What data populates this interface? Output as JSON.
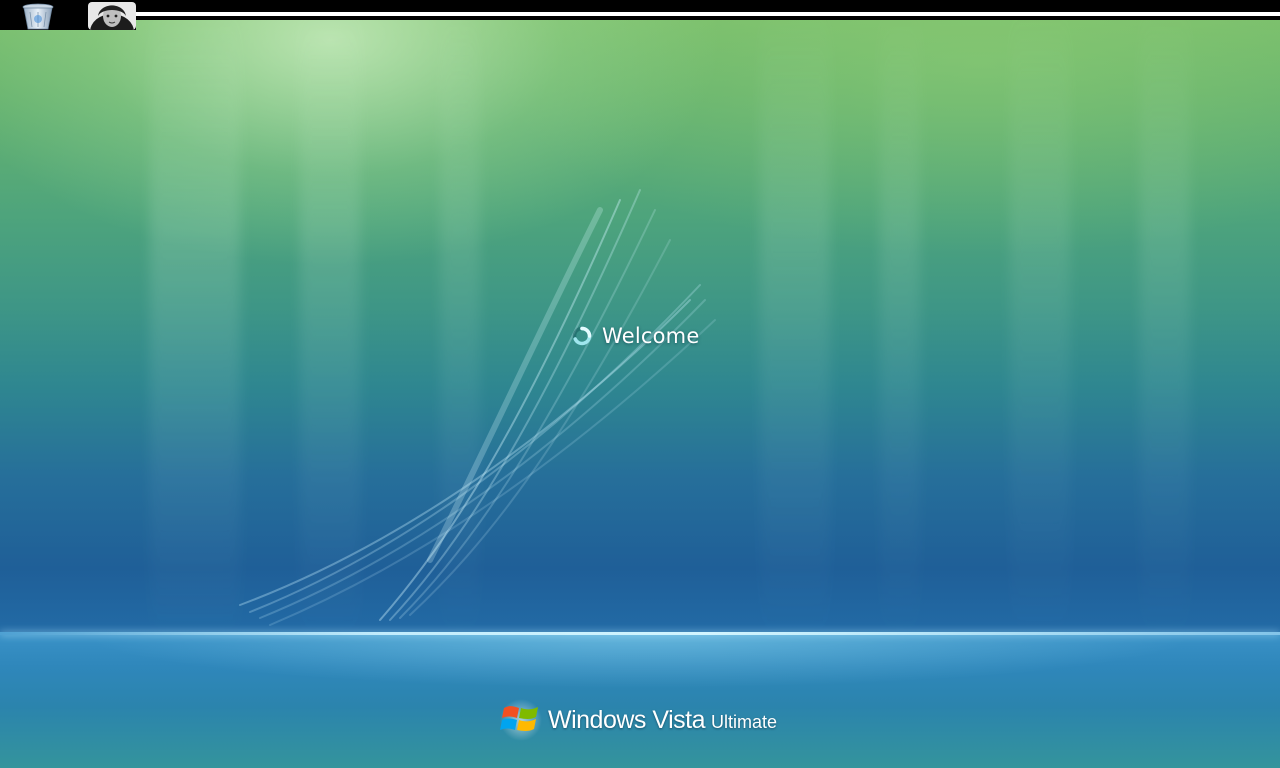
{
  "screen": {
    "status_text": "Welcome"
  },
  "branding": {
    "product_name": "Windows Vista",
    "edition": "Ultimate",
    "logo_icon": "windows-flag-icon"
  },
  "top_strip": {
    "icons": [
      {
        "name": "recycle-bin-icon"
      },
      {
        "name": "user-avatar-icon"
      }
    ]
  },
  "colors": {
    "sky_top": "#7cc06a",
    "sky_mid": "#2f8790",
    "sky_bottom": "#1f5f98",
    "horizon": "#d2f5ff",
    "floor": "#2b84ad",
    "text": "#ffffff"
  }
}
